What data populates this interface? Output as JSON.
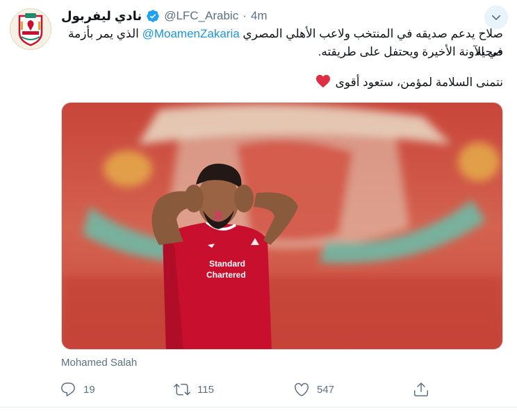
{
  "header": {
    "display_name": "نادي ليفربول",
    "handle": "@LFC_Arabic",
    "separator": "·",
    "time": "4m"
  },
  "tweet": {
    "line1_start": "صلاح يدعم صديقه في المنتخب ولاعب الأهلي المصري ",
    "mention": "@MoamenZakaria",
    "line1_end": " الذي يمر بأزمة صحية",
    "line2": "في الآونة الأخيرة ويحتفل على طريقته.",
    "line3": "نتمنى السلامة لمؤمن، ستعود أقوى"
  },
  "media": {
    "shirt_text_1": "Standard",
    "shirt_text_2": "Chartered"
  },
  "caption": "Mohamed Salah",
  "actions": {
    "reply_count": "19",
    "retweet_count": "115",
    "like_count": "547"
  },
  "colors": {
    "accent": "#1b95e0",
    "muted": "#5b7083",
    "heart": "#e0245e",
    "shirt_red": "#c8102e"
  }
}
